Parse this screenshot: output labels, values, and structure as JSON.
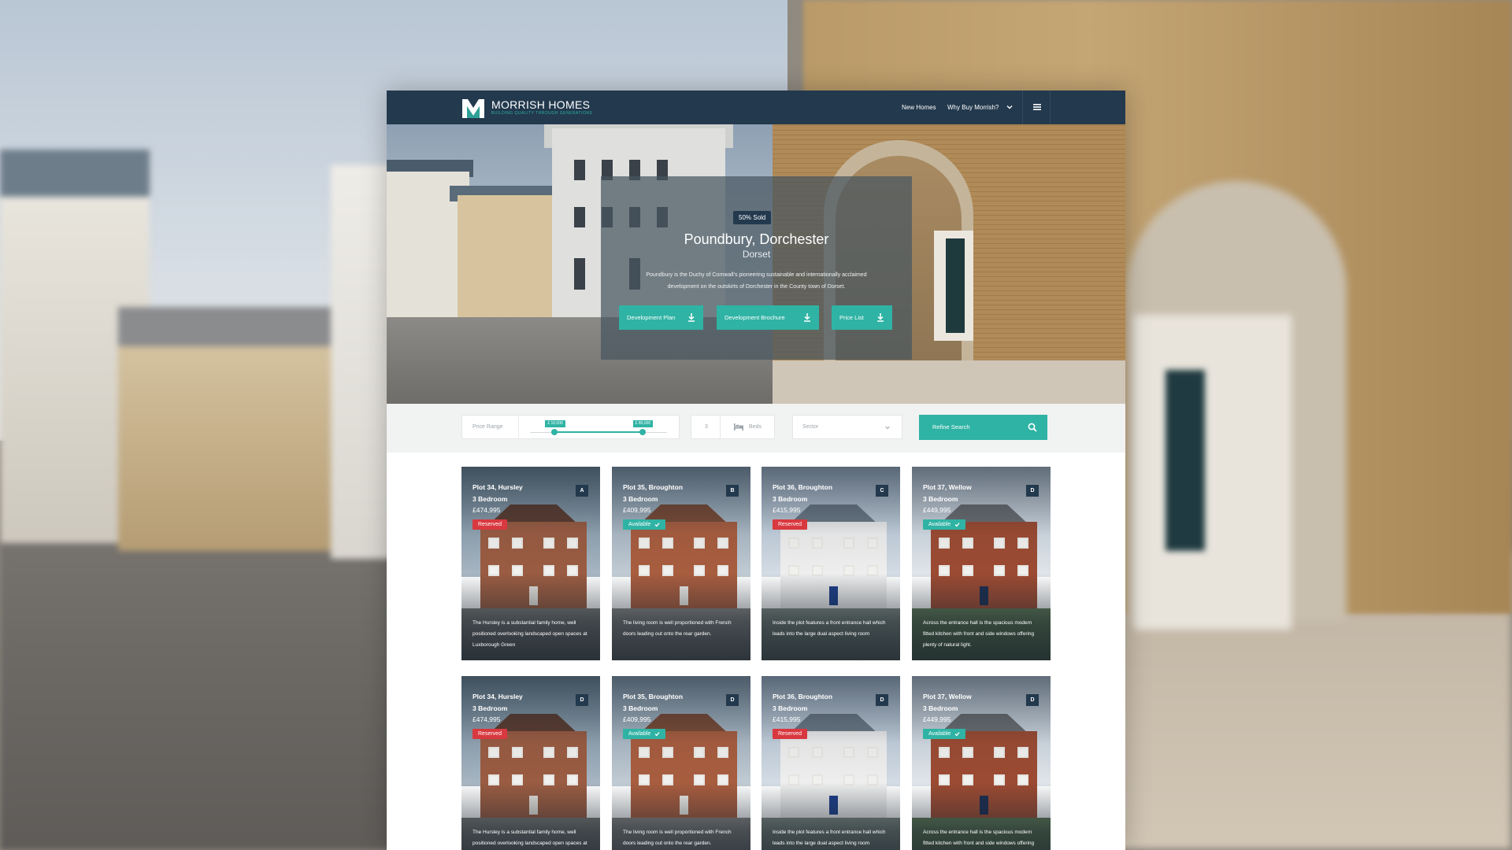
{
  "site": {
    "brand": "MORRISH HOMES",
    "tagline": "BUILDING QUALITY THROUGH GENERATIONS",
    "nav": {
      "new_homes": "New Homes",
      "why_buy": "Why Buy Morrish?"
    }
  },
  "hero": {
    "badge": "50% Sold",
    "title": "Poundbury, Dorchester",
    "subtitle": "Dorset",
    "description": "Poundbury is the Duchy of Cornwall's pioneering sustainable and internationally acclaimed development on the outskirts of Dorchester in the County town of Dorset.",
    "buttons": {
      "plan": "Development Plan",
      "brochure": "Development Brochure",
      "price_list": "Price List"
    }
  },
  "filter": {
    "price_label": "Price Range",
    "price_min": "£ 10,000",
    "price_max": "£ 80,000",
    "price_min_fraction": 0.18,
    "price_max_fraction": 0.82,
    "beds_value": "3",
    "beds_label": "Beds",
    "sector_placeholder": "Sector",
    "refine_label": "Refine Search"
  },
  "colors": {
    "navy": "#23394d",
    "teal": "#2fb3a4",
    "reserved": "#d8383f"
  },
  "cards": [
    {
      "title": "Plot 34, Hursley",
      "beds": "3 Bedroom",
      "price": "£474,995",
      "status": "Reserved",
      "letter": "A",
      "description": "The Hursley is a substantial family home, well positioned overlooking landscaped open spaces at Luxborough Green"
    },
    {
      "title": "Plot 35, Broughton",
      "beds": "3 Bedroom",
      "price": "£409,995",
      "status": "Available",
      "letter": "B",
      "description": "The living room is well proportioned with French doors leading out onto the rear garden."
    },
    {
      "title": "Plot 36, Broughton",
      "beds": "3 Bedroom",
      "price": "£415,995",
      "status": "Reserved",
      "letter": "C",
      "description": "Inside the plot features a front entrance hall which leads into the large dual aspect living room"
    },
    {
      "title": "Plot 37, Wellow",
      "beds": "3 Bedroom",
      "price": "£449,995",
      "status": "Available",
      "letter": "D",
      "description": "Across the entrance hall is the spacious modern fitted kitchen with front and side windows offering plenty of natural light."
    },
    {
      "title": "Plot 34, Hursley",
      "beds": "3 Bedroom",
      "price": "£474,995",
      "status": "Reserved",
      "letter": "D",
      "description": "The Hursley is a substantial family home, well positioned overlooking landscaped open spaces at Luxborough Green"
    },
    {
      "title": "Plot 35, Broughton",
      "beds": "3 Bedroom",
      "price": "£409,995",
      "status": "Available",
      "letter": "D",
      "description": "The living room is well proportioned with French doors leading out onto the rear garden."
    },
    {
      "title": "Plot 36, Broughton",
      "beds": "3 Bedroom",
      "price": "£415,995",
      "status": "Reserved",
      "letter": "D",
      "description": "Inside the plot features a front entrance hall which leads into the large dual aspect living room"
    },
    {
      "title": "Plot 37, Wellow",
      "beds": "3 Bedroom",
      "price": "£449,995",
      "status": "Available",
      "letter": "D",
      "description": "Across the entrance hall is the spacious modern fitted kitchen with front and side windows offering plenty of natural light."
    }
  ]
}
